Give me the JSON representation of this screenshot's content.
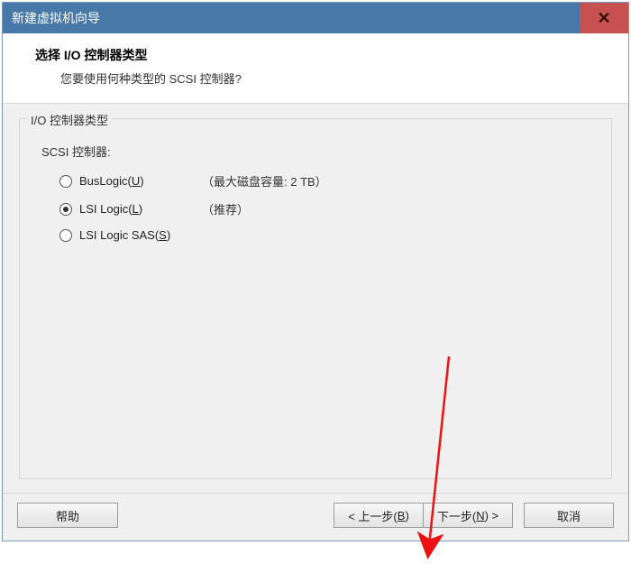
{
  "window": {
    "title": "新建虚拟机向导",
    "close_glyph": "✕"
  },
  "header": {
    "title": "选择 I/O 控制器类型",
    "subtitle": "您要使用何种类型的 SCSI 控制器?"
  },
  "group": {
    "legend": "I/O 控制器类型",
    "sub_label": "SCSI 控制器:",
    "options": [
      {
        "label_prefix": "BusLogic(",
        "accel": "U",
        "label_suffix": ")",
        "note": "（最大磁盘容量: 2 TB）",
        "selected": false
      },
      {
        "label_prefix": "LSI Logic(",
        "accel": "L",
        "label_suffix": ")",
        "note": "（推荐）",
        "selected": true
      },
      {
        "label_prefix": "LSI Logic SAS(",
        "accel": "S",
        "label_suffix": ")",
        "note": "",
        "selected": false
      }
    ]
  },
  "buttons": {
    "help": "帮助",
    "back_prefix": "< 上一步(",
    "back_accel": "B",
    "back_suffix": ")",
    "next_prefix": "下一步(",
    "next_accel": "N",
    "next_suffix": ") >",
    "cancel": "取消"
  }
}
